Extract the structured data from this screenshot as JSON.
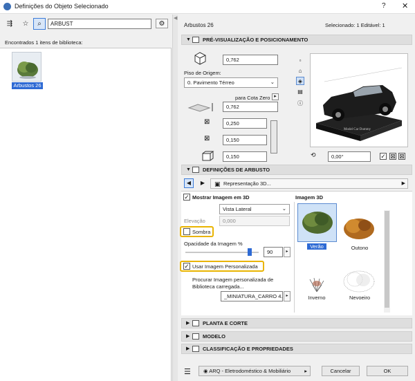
{
  "window": {
    "title": "Definições do Objeto Selecionado",
    "help": "?",
    "close": "✕"
  },
  "left": {
    "search_value": "ARBUST",
    "found_text": "Encontrados 1 itens de biblioteca:",
    "item_label": "Arbustos 26"
  },
  "right": {
    "object_name": "Arbustos 26",
    "selection_info": "Selecionado: 1 Editável: 1",
    "preview_section": {
      "title": "PRÉ-VISUALIZAÇÃO E POSICIONAMENTO",
      "height_value": "0,762",
      "origin_label": "Piso de Origem:",
      "origin_value": "0. Pavimento Térreo",
      "cota_label": "para Cota Zero",
      "elev_value": "0,762",
      "dim_a": "0,250",
      "dim_b": "0,150",
      "dim_c": "0,150",
      "angle": "0,00°",
      "preview_caption": "Model Car Dummy"
    },
    "shrub_section": {
      "title": "DEFINIÇÕES DE ARBUSTO",
      "rep_label": "Representação 3D...",
      "show_image_label": "Mostrar Imagem em 3D",
      "view_value": "Vista Lateral",
      "elevation_label": "Elevação",
      "elevation_value": "0,000",
      "shadow_label": "Sombra",
      "opacity_label": "Opacidade da Imagem %",
      "opacity_value": "90",
      "opacity_fraction": 0.9,
      "custom_label": "Usar Imagem Personalizada",
      "browse_label": "Procurar Imagem personalizada de Biblioteca carregada...",
      "custom_file": "_MINIATURA_CARRO 4.p",
      "image_panel_title": "Imagem 3D",
      "images": [
        {
          "label": "Verão",
          "selected": true
        },
        {
          "label": "Outono",
          "selected": false
        },
        {
          "label": "Inverno",
          "selected": false
        },
        {
          "label": "Nevoeiro",
          "selected": false
        }
      ]
    },
    "collapsed_sections": [
      "PLANTA E CORTE",
      "MODELO",
      "CLASSIFICAÇÃO E PROPRIEDADES"
    ],
    "footer": {
      "layer_value": "ARQ - Eletrodoméstico & Mobiliário",
      "cancel": "Cancelar",
      "ok": "OK"
    }
  },
  "colors": {
    "selection_blue": "#2e6ad4",
    "highlight": "#e9b400"
  }
}
